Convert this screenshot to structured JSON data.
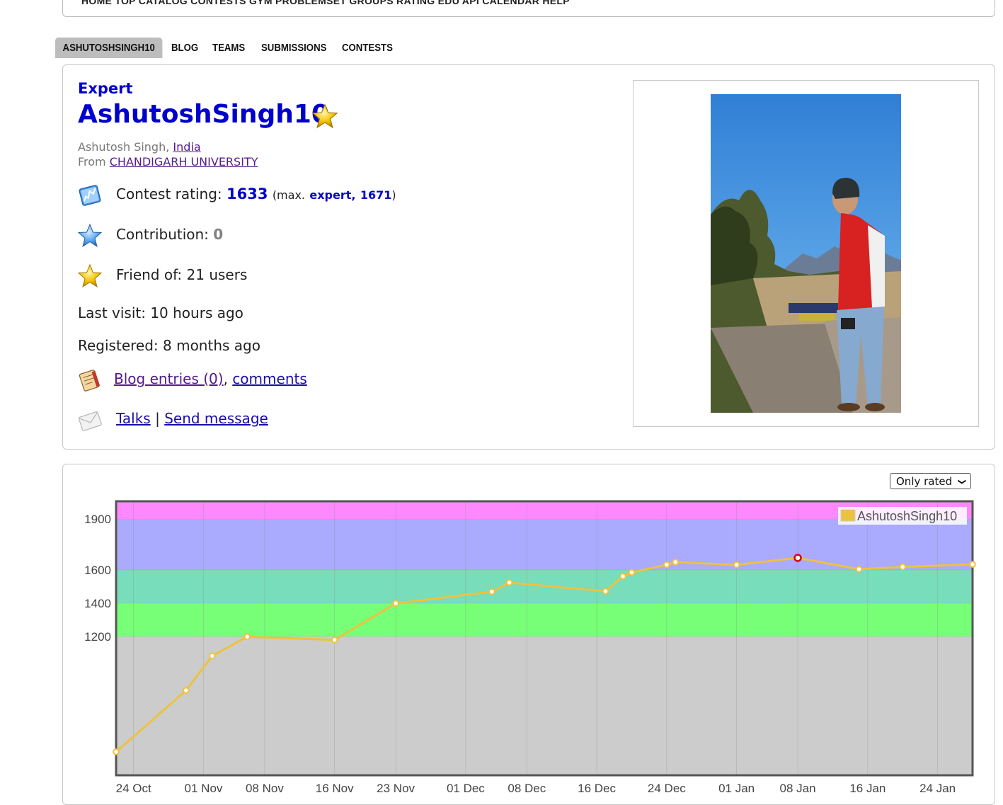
{
  "topnav": {
    "text": "HOME    TOP    CATALOG    CONTESTS    GYM    PROBLEMSET    GROUPS    RATING    EDU    API    CALENDAR    HELP"
  },
  "tabs": [
    "ASHUTOSHSINGH10",
    "BLOG",
    "TEAMS",
    "SUBMISSIONS",
    "CONTESTS"
  ],
  "profile": {
    "rank": "Expert",
    "handle": "AshutoshSingh10",
    "full_name": "Ashutosh Singh",
    "comma": ",",
    "country": "India",
    "from_label": "From",
    "organization": "CHANDIGARH UNIVERSITY",
    "rating_label": "Contest rating:",
    "rating": "1633",
    "max_prefix": "(max.",
    "max_rank": "expert,",
    "max_rating": "1671",
    "max_suffix": ")",
    "contribution_label": "Contribution:",
    "contribution": "0",
    "friend_of": "Friend of: 21 users",
    "last_visit": "Last visit: 10 hours ago",
    "registered": "Registered: 8 months ago",
    "blog_entries": "Blog entries (0)",
    "blog_sep": ",",
    "comments": "comments",
    "talks": "Talks",
    "talks_sep": "|",
    "send_message": "Send message"
  },
  "icons": {
    "rating": "rating-graph-icon",
    "contribution": "blue-star-icon",
    "friends": "gold-star-icon",
    "blog": "blog-notebook-icon",
    "talks": "envelope-icon"
  },
  "colors": {
    "expert": "#0000cc",
    "series": "#edc240",
    "band_candidate_master": "#ff88ff",
    "band_expert": "#aaaaff",
    "band_specialist": "#77ddbb",
    "band_pupil": "#77ff77",
    "band_newbie": "#cccccc"
  },
  "filter": {
    "selected": "Only rated"
  },
  "chart_data": {
    "type": "line",
    "legend": "AshutoshSingh10",
    "legend_position": "top-right",
    "grid": true,
    "x_ticks": [
      "24 Oct",
      "01 Nov",
      "08 Nov",
      "16 Nov",
      "23 Nov",
      "01 Dec",
      "08 Dec",
      "16 Dec",
      "24 Dec",
      "01 Jan",
      "08 Jan",
      "16 Jan",
      "24 Jan"
    ],
    "y_ticks": [
      1200,
      1400,
      1600,
      1900
    ],
    "xlim": [
      "2023-10-22",
      "2024-01-28"
    ],
    "ylim": [
      500,
      2000
    ],
    "series": [
      {
        "name": "AshutoshSingh10",
        "x": [
          "2023-10-22",
          "2023-10-30",
          "2023-11-02",
          "2023-11-06",
          "2023-11-16",
          "2023-11-23",
          "2023-12-04",
          "2023-12-06",
          "2023-12-17",
          "2023-12-19",
          "2023-12-20",
          "2023-12-24",
          "2023-12-25",
          "2024-01-01",
          "2024-01-08",
          "2024-01-15",
          "2024-01-20",
          "2024-01-28"
        ],
        "y": [
          618,
          928,
          1102,
          1199,
          1183,
          1399,
          1469,
          1524,
          1472,
          1562,
          1585,
          1631,
          1646,
          1630,
          1671,
          1604,
          1618,
          1633
        ],
        "highlight_index": 14
      }
    ],
    "bands": [
      {
        "from": 1900,
        "to": 2000,
        "color": "#ff88ff"
      },
      {
        "from": 1600,
        "to": 1900,
        "color": "#aaaaff"
      },
      {
        "from": 1400,
        "to": 1600,
        "color": "#77ddbb"
      },
      {
        "from": 1200,
        "to": 1400,
        "color": "#77ff77"
      },
      {
        "from": 500,
        "to": 1200,
        "color": "#cccccc"
      }
    ]
  }
}
